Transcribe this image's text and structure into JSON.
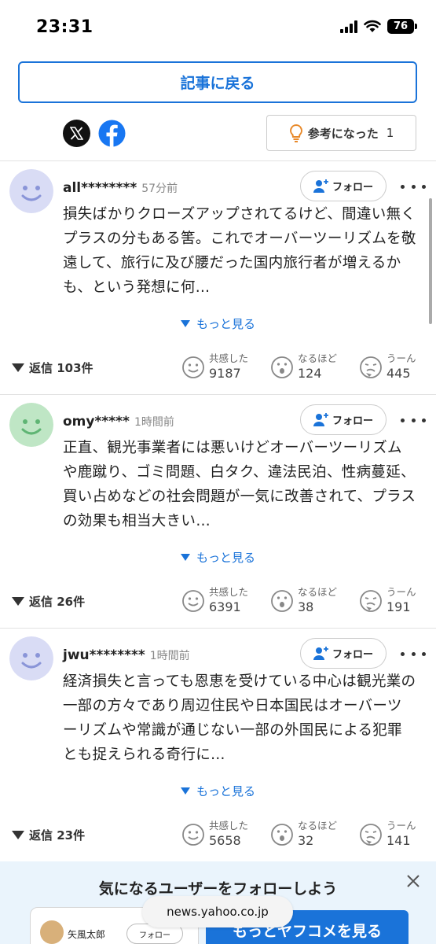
{
  "status_bar": {
    "time": "23:31",
    "battery": "76"
  },
  "nav": {
    "back_label": "記事に戻る"
  },
  "helpful": {
    "label": "参考になった",
    "count": "1"
  },
  "comments": [
    {
      "user": "all********",
      "time": "57分前",
      "follow_label": "フォロー",
      "text": "損失ばかりクローズアップされてるけど、間違い無くプラスの分もある筈。これでオーバーツーリズムを敬遠して、旅行に及び腰だった国内旅行者が増えるかも、という発想に何…",
      "show_more": "もっと見る",
      "replies": "返信 103件",
      "reactions": [
        {
          "label": "共感した",
          "count": "9187"
        },
        {
          "label": "なるほど",
          "count": "124"
        },
        {
          "label": "うーん",
          "count": "445"
        }
      ],
      "avatar_color": "#d9dcf5"
    },
    {
      "user": "omy*****",
      "time": "1時間前",
      "follow_label": "フォロー",
      "text": "正直、観光事業者には悪いけどオーバーツーリズムや鹿蹴り、ゴミ問題、白タク、違法民泊、性病蔓延、買い占めなどの社会問題が一気に改善されて、プラスの効果も相当大きい…",
      "show_more": "もっと見る",
      "replies": "返信 26件",
      "reactions": [
        {
          "label": "共感した",
          "count": "6391"
        },
        {
          "label": "なるほど",
          "count": "38"
        },
        {
          "label": "うーん",
          "count": "191"
        }
      ],
      "avatar_color": "#bfe6c5"
    },
    {
      "user": "jwu********",
      "time": "1時間前",
      "follow_label": "フォロー",
      "text": "経済損失と言っても恩恵を受けている中心は観光業の一部の方々であり周辺住民や日本国民はオーバーツーリズムや常識が通じない一部の外国民による犯罪とも捉えられる奇行に…",
      "show_more": "もっと見る",
      "replies": "返信 23件",
      "reactions": [
        {
          "label": "共感した",
          "count": "5658"
        },
        {
          "label": "なるほど",
          "count": "32"
        },
        {
          "label": "うーん",
          "count": "141"
        }
      ],
      "avatar_color": "#d9dcf5"
    }
  ],
  "banner": {
    "title": "気になるユーザーをフォローしよう",
    "card_name": "矢風太郎",
    "card_follow": "フォロー",
    "cta": "もっとヤフコメを見る"
  },
  "browser": {
    "url": "news.yahoo.co.jp"
  },
  "colors": {
    "accent": "#1a73d9"
  }
}
